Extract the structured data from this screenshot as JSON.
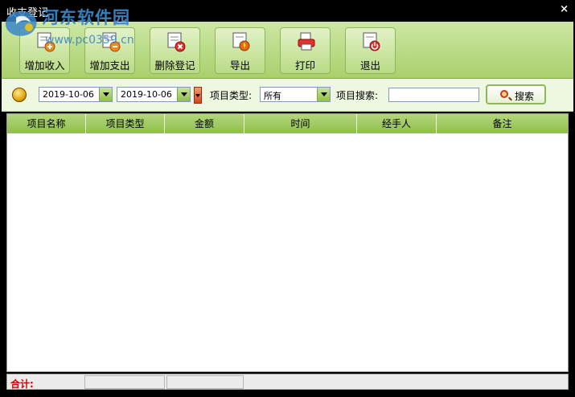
{
  "window": {
    "title": "收支登记",
    "close_glyph": "×"
  },
  "watermark": {
    "line1": "河东软件园",
    "line2": "www.pc0359.cn"
  },
  "toolbar": {
    "buttons": [
      {
        "label": "增加收入",
        "icon": "add-income-icon",
        "accent": "#f08a1c"
      },
      {
        "label": "增加支出",
        "icon": "add-expense-icon",
        "accent": "#f08a1c"
      },
      {
        "label": "删除登记",
        "icon": "delete-record-icon",
        "accent": "#e0322a"
      },
      {
        "label": "导出",
        "icon": "export-icon",
        "accent": "#e86a10"
      },
      {
        "label": "打印",
        "icon": "print-icon",
        "accent": "#e0322a"
      },
      {
        "label": "退出",
        "icon": "exit-icon",
        "accent": "#e0322a"
      }
    ]
  },
  "filters": {
    "date_from": "2019-10-06",
    "date_to": "2019-10-06",
    "type_label": "项目类型:",
    "type_value": "所有",
    "search_label": "项目搜索:",
    "search_value": "",
    "search_button": "搜索"
  },
  "table": {
    "columns": [
      "项目名称",
      "项目类型",
      "金额",
      "时间",
      "经手人",
      "备注"
    ],
    "rows": []
  },
  "status": {
    "total_label": "合计:"
  },
  "colors": {
    "toolbar_bg": "#b9db84",
    "header_bg": "#a2cc62",
    "total_label": "#d10000"
  }
}
